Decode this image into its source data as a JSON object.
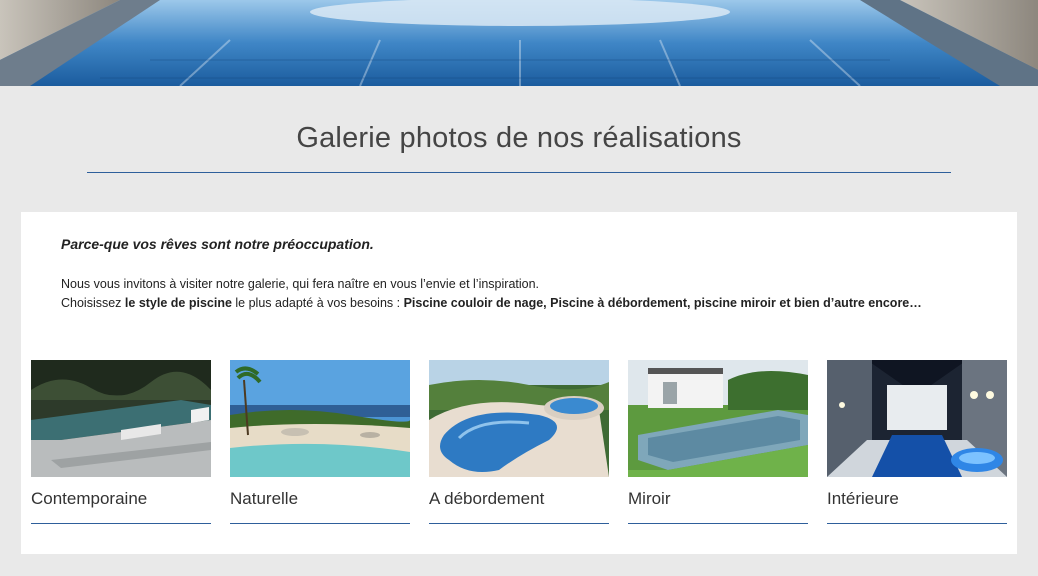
{
  "colors": {
    "background": "#e9e9e9",
    "panel": "#ffffff",
    "accent_rule": "#2e5f9b",
    "title_text": "#454545",
    "pool_blue": "#2f74b6"
  },
  "hero": {
    "image": "pool-lane-banner"
  },
  "header": {
    "title": "Galerie photos de nos réalisations"
  },
  "intro": {
    "tagline": "Parce-que vos rêves sont notre préoccupation.",
    "line1": "Nous vous invitons à visiter notre galerie, qui fera naître en vous l’envie et l’inspiration.",
    "line2_prefix": "Choisissez ",
    "line2_bold1": "le style de piscine",
    "line2_mid": " le plus adapté à vos besoins : ",
    "line2_bold2": "Piscine couloir de nage, Piscine à débordement, piscine miroir et bien d’autre encore…"
  },
  "gallery": {
    "items": [
      {
        "label": "Contemporaine",
        "image": "contemporary-pool-photo"
      },
      {
        "label": "Naturelle",
        "image": "natural-beach-pool-photo"
      },
      {
        "label": "A débordement",
        "image": "infinity-pool-photo"
      },
      {
        "label": "Miroir",
        "image": "mirror-pool-photo"
      },
      {
        "label": "Intérieure",
        "image": "indoor-pool-photo"
      }
    ]
  }
}
